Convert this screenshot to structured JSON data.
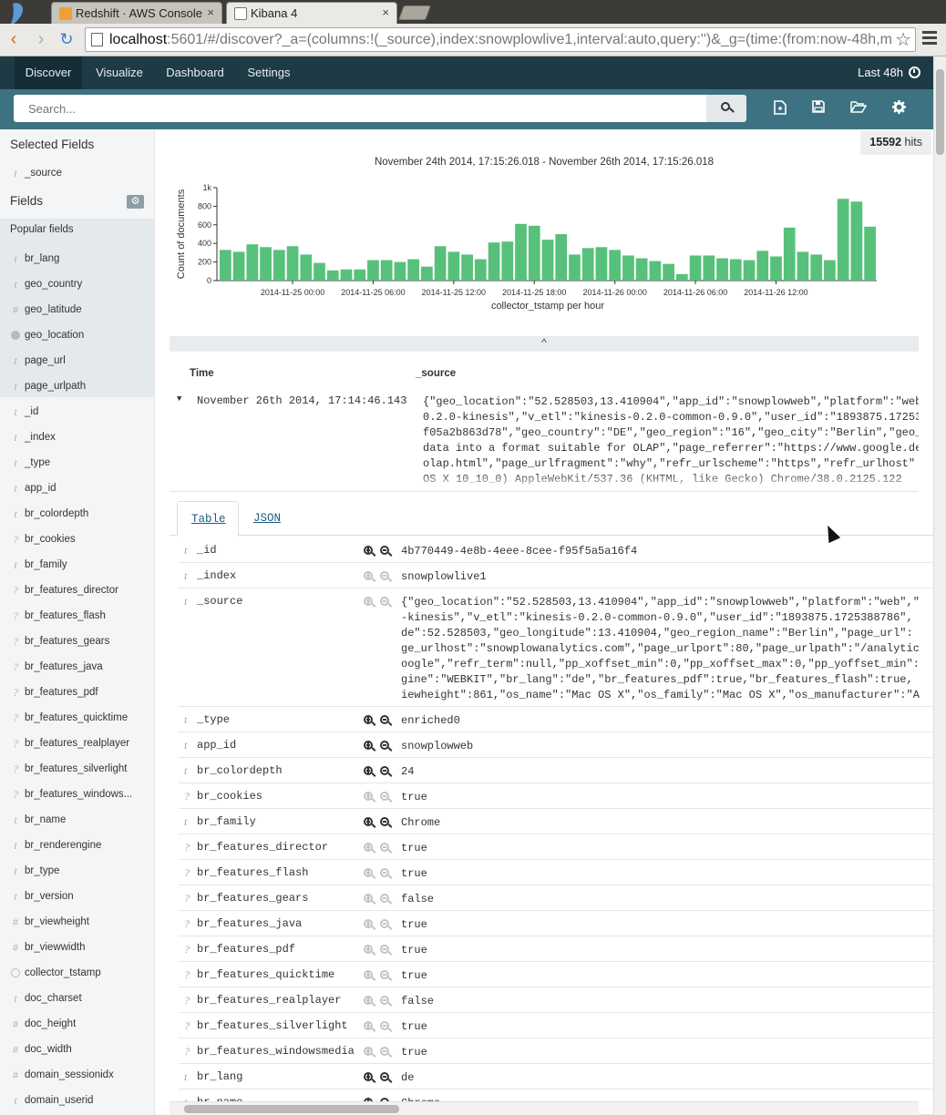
{
  "browser": {
    "tabs": [
      {
        "label": "Redshift · AWS Console",
        "color": "#f0a030"
      },
      {
        "label": "Kibana 4",
        "color": "#ffffff"
      }
    ],
    "url_host": "localhost",
    "url_rest": ":5601/#/discover?_a=(columns:!(_source),index:snowplowlive1,interval:auto,query:'')&_g=(time:(from:now-48h,m",
    "tab_close": "×"
  },
  "kibana_nav": {
    "items": [
      "Discover",
      "Visualize",
      "Dashboard",
      "Settings"
    ],
    "time_range": "Last 48h"
  },
  "search": {
    "placeholder": "Search..."
  },
  "sidebar": {
    "selected_fields_title": "Selected Fields",
    "selected_fields": [
      {
        "type": "t",
        "name": "_source"
      }
    ],
    "fields_title": "Fields",
    "popular_title": "Popular fields",
    "popular_fields": [
      {
        "type": "t",
        "name": "br_lang"
      },
      {
        "type": "t",
        "name": "geo_country"
      },
      {
        "type": "#",
        "name": "geo_latitude"
      },
      {
        "type": "globe",
        "name": "geo_location"
      },
      {
        "type": "t",
        "name": "page_url"
      },
      {
        "type": "t",
        "name": "page_urlpath"
      }
    ],
    "fields": [
      {
        "type": "t",
        "name": "_id"
      },
      {
        "type": "t",
        "name": "_index"
      },
      {
        "type": "t",
        "name": "_type"
      },
      {
        "type": "t",
        "name": "app_id"
      },
      {
        "type": "t",
        "name": "br_colordepth"
      },
      {
        "type": "?",
        "name": "br_cookies"
      },
      {
        "type": "t",
        "name": "br_family"
      },
      {
        "type": "?",
        "name": "br_features_director"
      },
      {
        "type": "?",
        "name": "br_features_flash"
      },
      {
        "type": "?",
        "name": "br_features_gears"
      },
      {
        "type": "?",
        "name": "br_features_java"
      },
      {
        "type": "?",
        "name": "br_features_pdf"
      },
      {
        "type": "?",
        "name": "br_features_quicktime"
      },
      {
        "type": "?",
        "name": "br_features_realplayer"
      },
      {
        "type": "?",
        "name": "br_features_silverlight"
      },
      {
        "type": "?",
        "name": "br_features_windows..."
      },
      {
        "type": "t",
        "name": "br_name"
      },
      {
        "type": "t",
        "name": "br_renderengine"
      },
      {
        "type": "t",
        "name": "br_type"
      },
      {
        "type": "t",
        "name": "br_version"
      },
      {
        "type": "#",
        "name": "br_viewheight"
      },
      {
        "type": "#",
        "name": "br_viewwidth"
      },
      {
        "type": "clock",
        "name": "collector_tstamp"
      },
      {
        "type": "t",
        "name": "doc_charset"
      },
      {
        "type": "#",
        "name": "doc_height"
      },
      {
        "type": "#",
        "name": "doc_width"
      },
      {
        "type": "#",
        "name": "domain_sessionidx"
      },
      {
        "type": "t",
        "name": "domain_userid"
      }
    ]
  },
  "hits": {
    "count": "15592",
    "label": "hits"
  },
  "chart_data": {
    "type": "bar",
    "title": "November 24th 2014, 17:15:26.018 - November 26th 2014, 17:15:26.018",
    "xlabel": "collector_tstamp per hour",
    "ylabel": "Count of documents",
    "ylim": [
      0,
      1000
    ],
    "yticks": [
      "0",
      "200",
      "400",
      "600",
      "800",
      "1k"
    ],
    "xticks": [
      "2014-11-25 00:00",
      "2014-11-25 06:00",
      "2014-11-25 12:00",
      "2014-11-25 18:00",
      "2014-11-26 00:00",
      "2014-11-26 06:00",
      "2014-11-26 12:00"
    ],
    "values": [
      330,
      310,
      390,
      360,
      330,
      370,
      280,
      190,
      110,
      120,
      120,
      220,
      220,
      200,
      230,
      150,
      370,
      310,
      280,
      230,
      410,
      420,
      610,
      590,
      440,
      500,
      280,
      350,
      360,
      330,
      270,
      240,
      210,
      180,
      70,
      270,
      270,
      240,
      230,
      220,
      320,
      260,
      570,
      310,
      280,
      220,
      880,
      850,
      580
    ],
    "color": "#57c17b"
  },
  "collapse_icon": "^",
  "doc_table": {
    "col_time": "Time",
    "col_source": "_source",
    "row_time": "November 26th 2014, 17:14:46.143",
    "row_source_lines": [
      "{\"geo_location\":\"52.528503,13.410904\",\"app_id\":\"snowplowweb\",\"platform\":\"web",
      "0.2.0-kinesis\",\"v_etl\":\"kinesis-0.2.0-common-0.9.0\",\"user_id\":\"1893875.172538",
      "f05a2b863d78\",\"geo_country\":\"DE\",\"geo_region\":\"16\",\"geo_city\":\"Berlin\",\"geo_",
      "data into a format suitable for OLAP\",\"page_referrer\":\"https://www.google.de",
      "olap.html\",\"page_urlfragment\":\"why\",\"refr_urlscheme\":\"https\",\"refr_urlhost\"",
      "OS X 10_10_0) AppleWebKit/537.36 (KHTML, like Gecko) Chrome/38.0.2125.122"
    ]
  },
  "detail_tabs": [
    "Table",
    "JSON"
  ],
  "detail_rows": [
    {
      "type": "t",
      "name": "_id",
      "filter": true,
      "value": "4b770449-4e8b-4eee-8cee-f95f5a5a16f4"
    },
    {
      "type": "t",
      "name": "_index",
      "filter": false,
      "value": "snowplowlive1"
    },
    {
      "type": "t",
      "name": "_source",
      "filter": false,
      "lines": [
        "{\"geo_location\":\"52.528503,13.410904\",\"app_id\":\"snowplowweb\",\"platform\":\"web\",\"",
        "-kinesis\",\"v_etl\":\"kinesis-0.2.0-common-0.9.0\",\"user_id\":\"1893875.1725388786\",",
        "de\":52.528503,\"geo_longitude\":13.410904,\"geo_region_name\":\"Berlin\",\"page_url\":",
        "ge_urlhost\":\"snowplowanalytics.com\",\"page_urlport\":80,\"page_urlpath\":\"/analytic",
        "oogle\",\"refr_term\":null,\"pp_xoffset_min\":0,\"pp_xoffset_max\":0,\"pp_yoffset_min\":",
        "gine\":\"WEBKIT\",\"br_lang\":\"de\",\"br_features_pdf\":true,\"br_features_flash\":true,",
        "iewheight\":861,\"os_name\":\"Mac OS X\",\"os_family\":\"Mac OS X\",\"os_manufacturer\":\"A"
      ]
    },
    {
      "type": "t",
      "name": "_type",
      "filter": true,
      "value": "enriched0"
    },
    {
      "type": "t",
      "name": "app_id",
      "filter": true,
      "value": "snowplowweb"
    },
    {
      "type": "t",
      "name": "br_colordepth",
      "filter": true,
      "value": "24"
    },
    {
      "type": "?",
      "name": "br_cookies",
      "filter": false,
      "value": "true"
    },
    {
      "type": "t",
      "name": "br_family",
      "filter": true,
      "value": "Chrome"
    },
    {
      "type": "?",
      "name": "br_features_director",
      "filter": false,
      "value": "true"
    },
    {
      "type": "?",
      "name": "br_features_flash",
      "filter": false,
      "value": "true"
    },
    {
      "type": "?",
      "name": "br_features_gears",
      "filter": false,
      "value": "false"
    },
    {
      "type": "?",
      "name": "br_features_java",
      "filter": false,
      "value": "true"
    },
    {
      "type": "?",
      "name": "br_features_pdf",
      "filter": false,
      "value": "true"
    },
    {
      "type": "?",
      "name": "br_features_quicktime",
      "filter": false,
      "value": "true"
    },
    {
      "type": "?",
      "name": "br_features_realplayer",
      "filter": false,
      "value": "false"
    },
    {
      "type": "?",
      "name": "br_features_silverlight",
      "filter": false,
      "value": "true"
    },
    {
      "type": "?",
      "name": "br_features_windowsmedia",
      "filter": false,
      "value": "true"
    },
    {
      "type": "t",
      "name": "br_lang",
      "filter": true,
      "value": "de"
    },
    {
      "type": "t",
      "name": "br_name",
      "filter": true,
      "value": "Chrome"
    }
  ]
}
